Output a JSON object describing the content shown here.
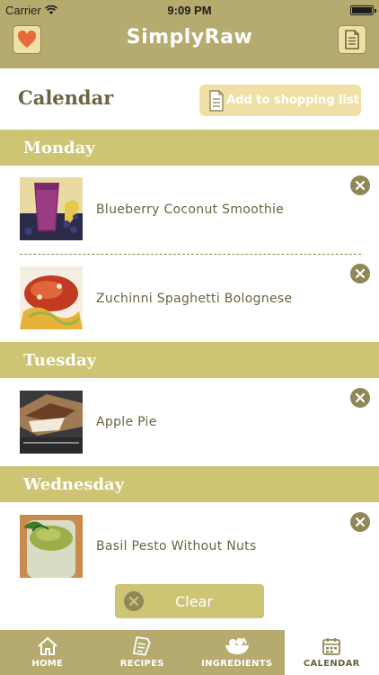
{
  "status_bar": {
    "carrier": "Carrier",
    "time": "9:09 PM"
  },
  "nav": {
    "title": "SimplyRaw",
    "left_icon": "heart-icon",
    "right_icon": "document-icon"
  },
  "calendar": {
    "heading": "Calendar",
    "shopping_button": "Add to shopping list"
  },
  "days": [
    {
      "name": "Monday",
      "items": [
        "Blueberry Coconut Smoothie",
        "Zuchinni Spaghetti Bolognese"
      ]
    },
    {
      "name": "Tuesday",
      "items": [
        "Apple Pie"
      ]
    },
    {
      "name": "Wednesday",
      "items": [
        "Basil Pesto Without Nuts"
      ]
    }
  ],
  "clear_button": "Clear",
  "tabs": [
    {
      "label": "HOME",
      "icon": "home-icon"
    },
    {
      "label": "RECIPES",
      "icon": "recipes-icon"
    },
    {
      "label": "INGREDIENTS",
      "icon": "ingredients-icon"
    },
    {
      "label": "CALENDAR",
      "icon": "calendar-icon",
      "active": true
    }
  ],
  "colors": {
    "bar": "#b5ab6e",
    "day_header": "#cdc474",
    "light_button": "#efe1a6",
    "text": "#6b6440"
  }
}
